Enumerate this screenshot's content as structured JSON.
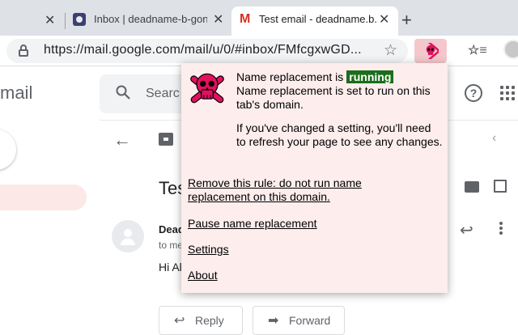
{
  "browser": {
    "tabs": [
      {
        "label": ""
      },
      {
        "label": "Inbox | deadname-b-gon-"
      },
      {
        "label": "Test email - deadname.b.g",
        "favicon": "M"
      }
    ],
    "new_tab_label": "+",
    "close_glyph": "✕",
    "url": "https://mail.google.com/mail/u/0/#inbox/FMfcgxwGD..."
  },
  "gmail": {
    "product_name": "mail",
    "search_placeholder": "Searc",
    "help_label": "?",
    "subject": "Tes",
    "sender": "Dead",
    "to_me": "to me",
    "body_preview": "Hi Al",
    "reply_label": "Reply",
    "forward_label": "Forward"
  },
  "popup": {
    "status_prefix": "Name replacement is",
    "status_badge": "running",
    "domain_note": "Name replacement is set to run on this tab's domain.",
    "refresh_note": "If you've changed a setting, you'll need to refresh your page to see any changes.",
    "links": {
      "remove_rule": "Remove this rule: do not run name replacement on this domain.",
      "pause": "Pause name replacement",
      "settings": "Settings",
      "about": "About"
    }
  },
  "colors": {
    "popup_bg": "#fdeded",
    "running_badge": "#1b6e1b",
    "skull_pink": "#e0115f",
    "gmail_red": "#d93025"
  },
  "icons": [
    "close-icon",
    "mail-favicon",
    "lock-icon",
    "star-icon",
    "skull-crossbones-icon",
    "reading-list-icon",
    "profile-avatar",
    "search-icon",
    "help-icon",
    "apps-grid-icon",
    "back-arrow-icon",
    "archive-icon",
    "chevron-left-icon",
    "print-icon",
    "open-in-new-window-icon",
    "reply-icon",
    "more-vert-icon",
    "forward-icon"
  ]
}
